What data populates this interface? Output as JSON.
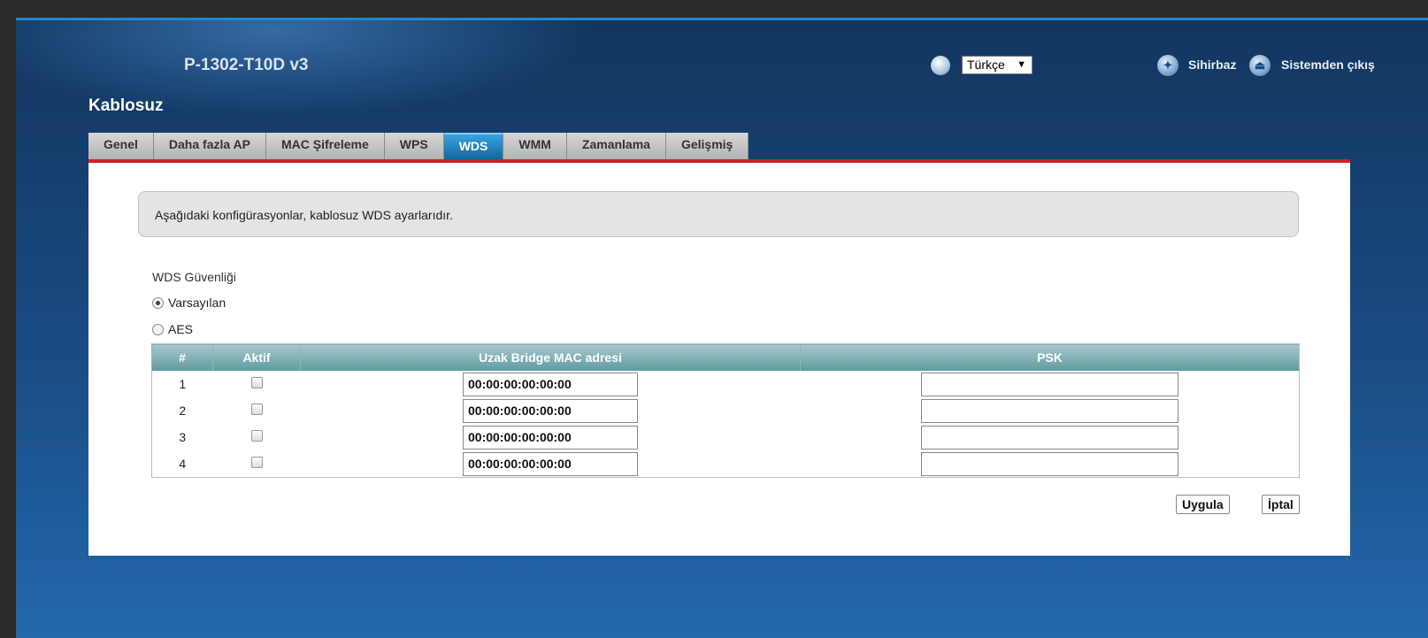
{
  "header": {
    "model": "P-1302-T10D v3",
    "language": "Türkçe",
    "wizard_label": "Sihirbaz",
    "logout_label": "Sistemden çıkış"
  },
  "section_title": "Kablosuz",
  "tabs": [
    {
      "label": "Genel",
      "active": false
    },
    {
      "label": "Daha fazla AP",
      "active": false
    },
    {
      "label": "MAC Şifreleme",
      "active": false
    },
    {
      "label": "WPS",
      "active": false
    },
    {
      "label": "WDS",
      "active": true
    },
    {
      "label": "WMM",
      "active": false
    },
    {
      "label": "Zamanlama",
      "active": false
    },
    {
      "label": "Gelişmiş",
      "active": false
    }
  ],
  "info_text": "Aşağıdaki konfigürasyonlar, kablosuz WDS ayarlarıdır.",
  "security": {
    "label": "WDS Güvenliği",
    "options": [
      {
        "label": "Varsayılan",
        "checked": true
      },
      {
        "label": "AES",
        "checked": false
      }
    ]
  },
  "table": {
    "headers": [
      "#",
      "Aktif",
      "Uzak Bridge MAC adresi",
      "PSK"
    ],
    "rows": [
      {
        "index": "1",
        "active": false,
        "mac": "00:00:00:00:00:00",
        "psk": ""
      },
      {
        "index": "2",
        "active": false,
        "mac": "00:00:00:00:00:00",
        "psk": ""
      },
      {
        "index": "3",
        "active": false,
        "mac": "00:00:00:00:00:00",
        "psk": ""
      },
      {
        "index": "4",
        "active": false,
        "mac": "00:00:00:00:00:00",
        "psk": ""
      }
    ]
  },
  "buttons": {
    "apply": "Uygula",
    "cancel": "İptal"
  },
  "colors": {
    "accent_red": "#d21f26",
    "active_tab": "#1f86c6",
    "table_header": "#7eaeb4"
  },
  "icons": {
    "language": "globe-icon",
    "wizard": "wizard-star-icon",
    "logout": "logout-icon"
  }
}
